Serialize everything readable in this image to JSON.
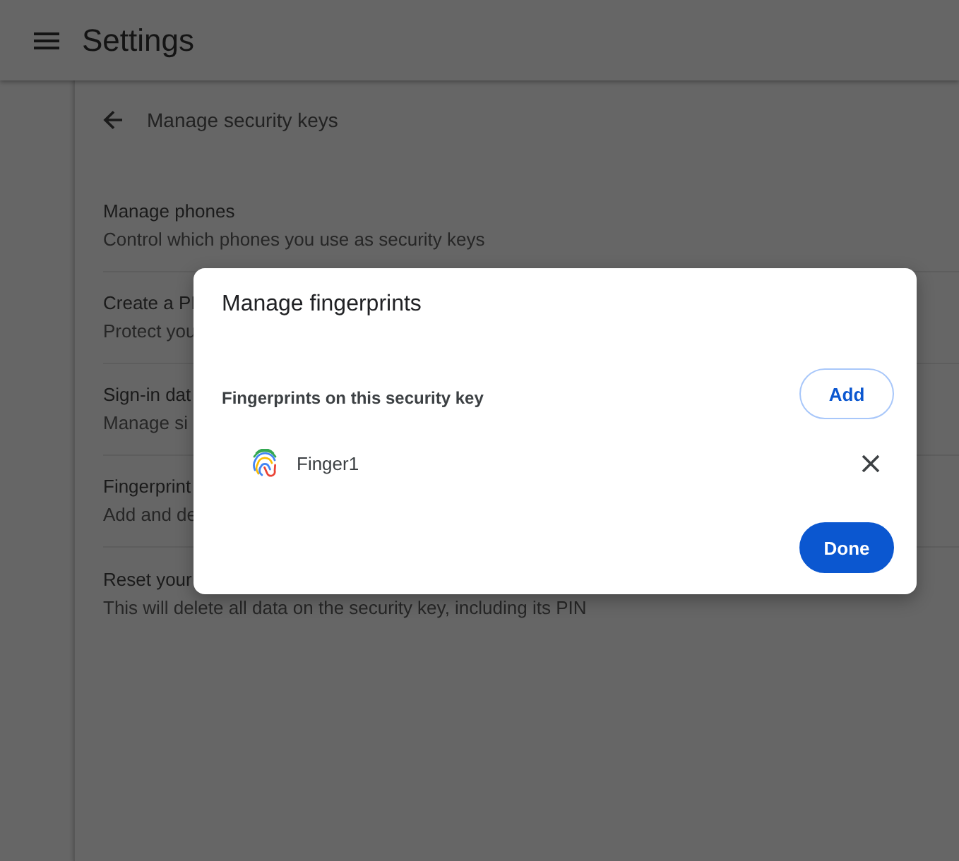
{
  "header": {
    "title": "Settings"
  },
  "page": {
    "title": "Manage security keys"
  },
  "rows": [
    {
      "title": "Manage phones",
      "description": "Control which phones you use as security keys"
    },
    {
      "title": "Create a PI",
      "description": "Protect you"
    },
    {
      "title": "Sign-in dat",
      "description": "Manage si"
    },
    {
      "title": "Fingerprint",
      "description": "Add and de"
    },
    {
      "title": "Reset your",
      "description": "This will delete all data on the security key, including its PIN"
    }
  ],
  "dialog": {
    "title": "Manage fingerprints",
    "section_label": "Fingerprints on this security key",
    "add_button": "Add",
    "fingerprints": [
      {
        "name": "Finger1"
      }
    ],
    "done_button": "Done"
  }
}
